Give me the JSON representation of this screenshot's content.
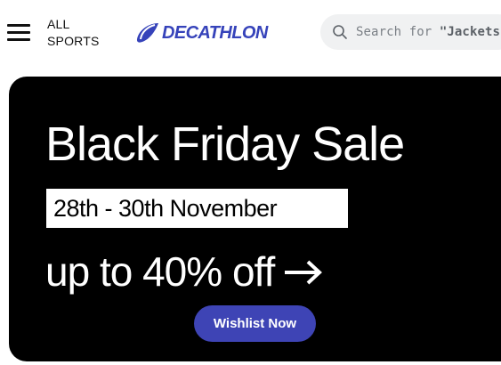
{
  "header": {
    "menu_icon": "hamburger-menu-icon",
    "all_sports_line1": "ALL",
    "all_sports_line2": "SPORTS",
    "logo_text": "DECATHLON",
    "brand_color": "#3643ba",
    "search": {
      "icon": "search-icon",
      "prefix": "Search for ",
      "term": "\"Jackets\"",
      "cursor": "|"
    }
  },
  "banner": {
    "headline": "Black Friday Sale",
    "dates": "28th - 30th November",
    "offer": "up to 40% off",
    "arrow_icon": "right-arrow-icon",
    "cta_label": "Wishlist Now",
    "background_color": "#000000",
    "cta_color": "#3e44b5"
  }
}
